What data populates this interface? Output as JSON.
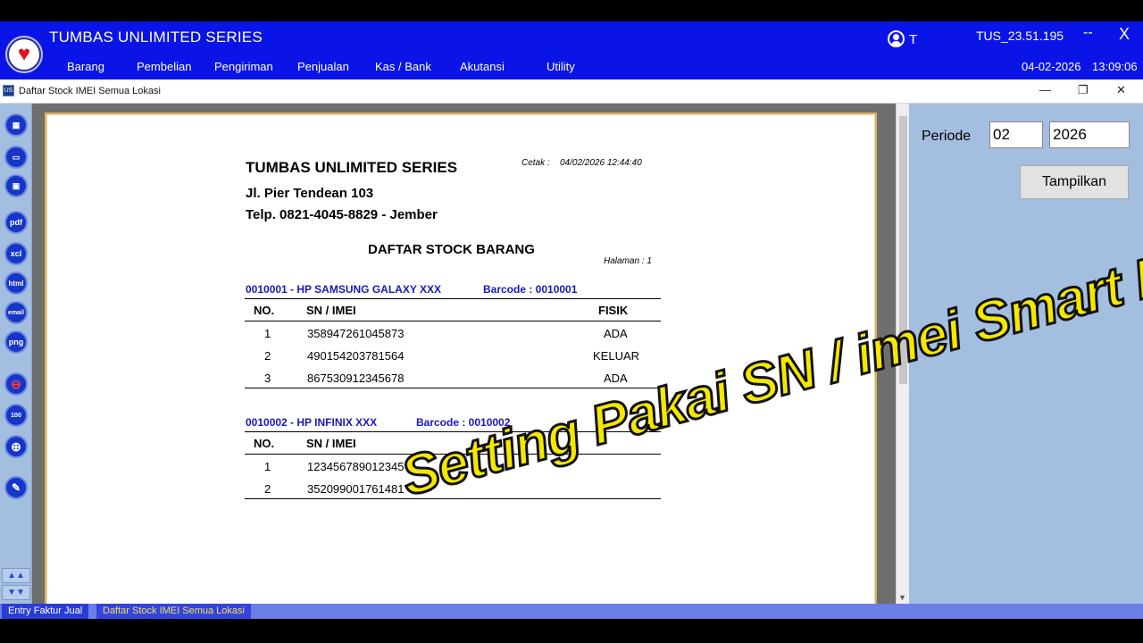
{
  "app": {
    "title": "TUMBAS UNLIMITED SERIES",
    "user": "T",
    "version": "TUS_23.51.195",
    "minimize": "--",
    "close": "X",
    "date": "04-02-2026",
    "time": "13:09:06",
    "menu": [
      "Barang",
      "Pembelian",
      "Pengiriman",
      "Penjualan",
      "Kas / Bank",
      "Akutansi",
      "Utility"
    ]
  },
  "window": {
    "icon_text": "US",
    "title": "Daftar Stock IMEI Semua Lokasi",
    "minimize": "—",
    "restore": "❐",
    "close": "✕"
  },
  "toolbar": {
    "buttons": [
      "▦",
      "▭",
      "▣",
      "pdf",
      "xcl",
      "html",
      "email",
      "png",
      "⊖",
      "100",
      "⊕",
      "✎"
    ],
    "up": "▲▲",
    "down": "▼▼"
  },
  "report": {
    "company": "TUMBAS UNLIMITED SERIES",
    "address": "Jl. Pier Tendean 103",
    "phone": "Telp. 0821-4045-8829 - Jember",
    "print_label": "Cetak :",
    "print_time": "04/02/2026 12:44:40",
    "title": "DAFTAR STOCK BARANG",
    "page_label": "Halaman : 1",
    "groups": [
      {
        "item": "0010001 - HP SAMSUNG GALAXY XXX",
        "barcode": "Barcode : 0010001",
        "col_no": "NO.",
        "col_sn": "SN / IMEI",
        "col_fisik": "FISIK",
        "rows": [
          {
            "no": "1",
            "sn": "358947261045873",
            "fisik": "ADA"
          },
          {
            "no": "2",
            "sn": "490154203781564",
            "fisik": "KELUAR"
          },
          {
            "no": "3",
            "sn": "867530912345678",
            "fisik": "ADA"
          }
        ]
      },
      {
        "item": "0010002 - HP INFINIX XXX",
        "barcode": "Barcode : 0010002",
        "col_no": "NO.",
        "col_sn": "SN / IMEI",
        "rows": [
          {
            "no": "1",
            "sn": "123456789012345"
          },
          {
            "no": "2",
            "sn": "352099001761481"
          }
        ]
      }
    ]
  },
  "panel": {
    "periode_label": "Periode",
    "month": "02",
    "year": "2026",
    "button": "Tampilkan"
  },
  "tabs": [
    "Entry Faktur Jual",
    "Daftar Stock IMEI Semua Lokasi"
  ],
  "overlay": "Setting Pakai SN / imei Smart Phone",
  "colors": {
    "title_bar": "#0a14e6",
    "panel": "#a4bee0",
    "overlay_text": "#f5e800",
    "report_blue": "#1a1ab4"
  }
}
